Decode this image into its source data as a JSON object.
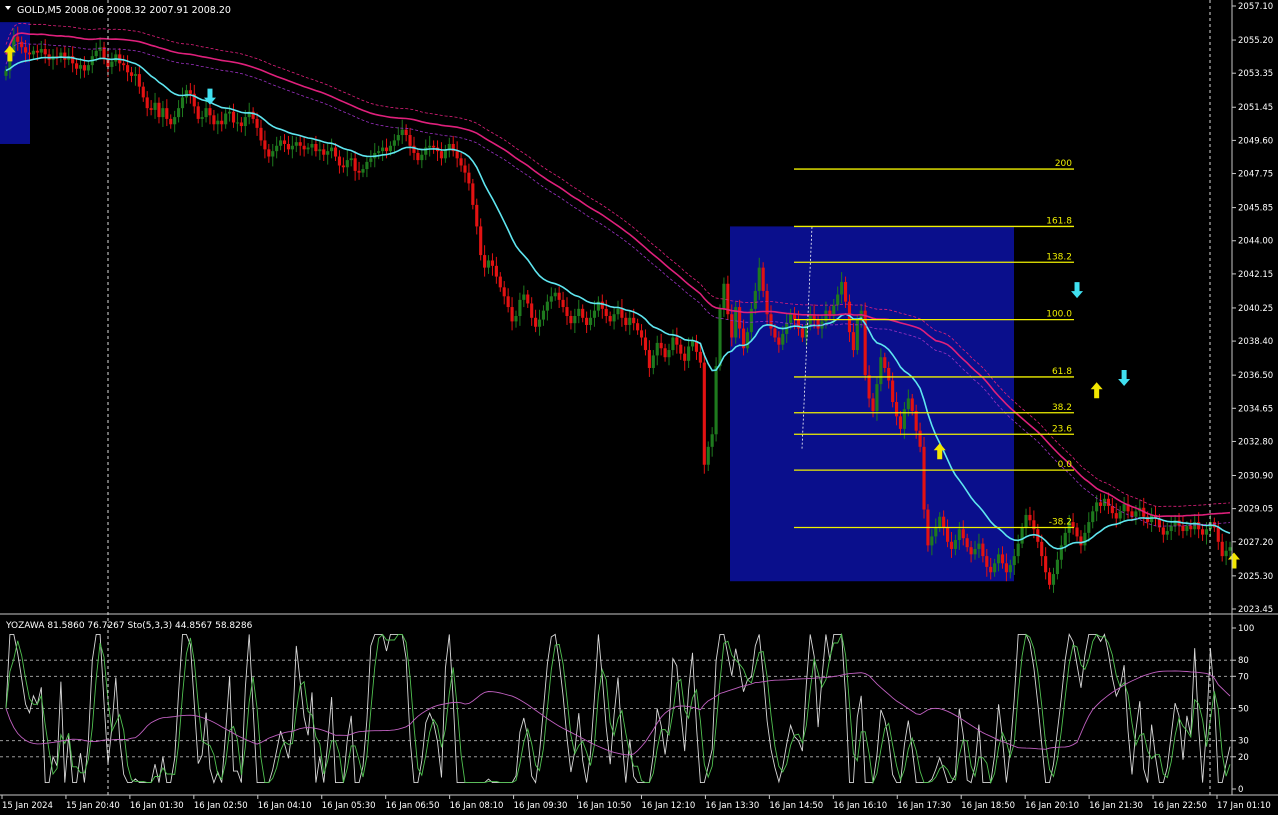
{
  "header": {
    "symbol_text": "GOLD,M5  2008.06 2008.32 2007.91 2008.20",
    "indicator_text": "YOZAWA 81.5860 76.7267  Sto(5,3,3) 44.8567 58.8286"
  },
  "colors": {
    "background": "#000000",
    "bull": "#1e7a1e",
    "bear": "#e31212",
    "ma_fast": "#5fe6f0",
    "ma_slow": "#e0207c",
    "fib_zone": "#0a0f8c",
    "fib_line": "#f0f000",
    "arrow_up": "#f2e600",
    "arrow_down": "#40e0f0",
    "grid": "#b4b4b4",
    "axis_text": "#ffffff",
    "osc_fast": "#d8d8d8",
    "osc_signal": "#c060c0",
    "osc_third": "#50c050"
  },
  "chart_data": [
    {
      "type": "candlestick",
      "title": "GOLD,M5  2008.06 2008.32 2007.91 2008.20",
      "ylim": [
        2023.45,
        2057.1
      ],
      "price_ticks": [
        "2057.10",
        "2055.20",
        "2053.35",
        "2051.45",
        "2049.60",
        "2047.75",
        "2045.85",
        "2044.00",
        "2042.15",
        "2040.25",
        "2038.40",
        "2036.50",
        "2034.65",
        "2032.80",
        "2030.90",
        "2029.05",
        "2027.20",
        "2025.30",
        "2023.45"
      ],
      "time_ticks": [
        "15 Jan 2024",
        "15 Jan 20:40",
        "16 Jan 01:30",
        "16 Jan 02:50",
        "16 Jan 04:10",
        "16 Jan 05:30",
        "16 Jan 06:50",
        "16 Jan 08:10",
        "16 Jan 09:30",
        "16 Jan 10:50",
        "16 Jan 12:10",
        "16 Jan 13:30",
        "16 Jan 14:50",
        "16 Jan 16:10",
        "16 Jan 17:30",
        "16 Jan 18:50",
        "16 Jan 20:10",
        "16 Jan 21:30",
        "16 Jan 22:50",
        "17 Jan 01:10"
      ],
      "closes": [
        2053.5,
        2054.6,
        2055.4,
        2055.1,
        2054.8,
        2054.5,
        2054.4,
        2054.6,
        2054.5,
        2054.7,
        2054.4,
        2054.1,
        2054.3,
        2054.2,
        2054.5,
        2054.1,
        2054.3,
        2053.9,
        2053.6,
        2053.8,
        2053.5,
        2053.8,
        2054.3,
        2054.6,
        2054.8,
        2054.2,
        2053.7,
        2054.0,
        2054.4,
        2053.9,
        2053.8,
        2053.4,
        2053.2,
        2053.3,
        2052.6,
        2052.0,
        2051.4,
        2051.3,
        2051.7,
        2050.9,
        2051.4,
        2050.8,
        2050.5,
        2050.9,
        2051.4,
        2052.0,
        2052.4,
        2052.2,
        2051.5,
        2050.8,
        2050.9,
        2051.4,
        2051.0,
        2050.5,
        2050.7,
        2050.5,
        2051.1,
        2051.2,
        2050.6,
        2050.6,
        2050.4,
        2050.9,
        2051.2,
        2050.8,
        2050.3,
        2049.6,
        2049.1,
        2048.7,
        2049.0,
        2049.3,
        2049.6,
        2049.4,
        2049.1,
        2049.3,
        2049.5,
        2049.3,
        2049.1,
        2049.2,
        2049.4,
        2049.0,
        2049.1,
        2048.8,
        2049.0,
        2049.2,
        2048.7,
        2048.2,
        2048.1,
        2048.5,
        2048.6,
        2047.9,
        2047.8,
        2048.0,
        2048.4,
        2048.6,
        2048.9,
        2049.0,
        2049.2,
        2049.0,
        2049.3,
        2049.6,
        2049.9,
        2050.2,
        2049.9,
        2049.3,
        2048.9,
        2048.5,
        2048.8,
        2049.2,
        2049.3,
        2049.2,
        2049.0,
        2048.6,
        2049.1,
        2049.4,
        2049.0,
        2048.6,
        2048.2,
        2047.8,
        2047.2,
        2046.0,
        2044.8,
        2043.2,
        2042.5,
        2042.9,
        2042.6,
        2042.0,
        2041.4,
        2040.9,
        2040.3,
        2039.5,
        2039.8,
        2040.7,
        2041.0,
        2040.5,
        2039.7,
        2039.2,
        2039.6,
        2040.1,
        2040.6,
        2040.9,
        2041.1,
        2040.7,
        2040.3,
        2039.8,
        2039.4,
        2039.8,
        2040.2,
        2039.7,
        2039.3,
        2039.7,
        2040.1,
        2040.6,
        2040.2,
        2039.8,
        2039.5,
        2039.9,
        2040.2,
        2039.7,
        2039.3,
        2039.7,
        2039.4,
        2039.0,
        2038.6,
        2037.9,
        2036.9,
        2037.6,
        2038.3,
        2038.0,
        2037.5,
        2037.9,
        2038.6,
        2038.2,
        2037.7,
        2037.3,
        2038.1,
        2038.4,
        2037.8,
        2037.2,
        2031.5,
        2032.5,
        2033.2,
        2037.0,
        2040.2,
        2041.6,
        2039.9,
        2038.6,
        2040.3,
        2039.1,
        2038.0,
        2038.9,
        2040.2,
        2041.2,
        2042.5,
        2041.2,
        2039.9,
        2039.1,
        2038.6,
        2038.2,
        2038.8,
        2039.4,
        2039.9,
        2039.6,
        2039.1,
        2038.6,
        2039.3,
        2039.9,
        2039.6,
        2039.1,
        2039.5,
        2040.1,
        2039.8,
        2040.4,
        2041.0,
        2041.7,
        2040.6,
        2038.9,
        2037.9,
        2039.6,
        2040.1,
        2036.5,
        2035.2,
        2034.5,
        2036.0,
        2037.5,
        2036.9,
        2036.2,
        2035.0,
        2034.2,
        2033.5,
        2034.6,
        2035.2,
        2034.5,
        2033.4,
        2032.5,
        2029.0,
        2027.0,
        2027.5,
        2028.0,
        2028.6,
        2028.0,
        2027.2,
        2026.8,
        2027.3,
        2027.9,
        2027.4,
        2026.9,
        2026.5,
        2026.8,
        2027.1,
        2026.4,
        2025.8,
        2025.5,
        2026.0,
        2026.5,
        2026.0,
        2025.5,
        2025.9,
        2026.4,
        2027.1,
        2028.0,
        2028.7,
        2028.4,
        2027.9,
        2027.2,
        2026.4,
        2025.5,
        2024.8,
        2025.4,
        2026.2,
        2027.0,
        2027.7,
        2028.3,
        2028.0,
        2027.5,
        2027.0,
        2027.7,
        2028.3,
        2028.9,
        2029.4,
        2029.2,
        2029.6,
        2029.2,
        2028.8,
        2028.5,
        2028.9,
        2029.3,
        2028.9,
        2028.6,
        2028.9,
        2029.1,
        2028.6,
        2028.3,
        2028.7,
        2028.5,
        2028.0,
        2027.6,
        2027.8,
        2028.1,
        2028.4,
        2028.1,
        2027.8,
        2028.1,
        2027.9,
        2028.3,
        2027.9,
        2027.6,
        2027.9,
        2028.3,
        2028.0,
        2027.2,
        2026.4,
        2026.7,
        2026.9
      ],
      "fibonacci": {
        "levels": [
          {
            "label": "200",
            "price": 2048.0
          },
          {
            "label": "161.8",
            "price": 2044.8
          },
          {
            "label": "138.2",
            "price": 2042.8
          },
          {
            "label": "100.0",
            "price": 2039.6
          },
          {
            "label": "61.8",
            "price": 2036.4
          },
          {
            "label": "38.2",
            "price": 2034.4
          },
          {
            "label": "23.6",
            "price": 2033.2
          },
          {
            "label": "0.0",
            "price": 2031.2
          },
          {
            "label": "-38.2",
            "price": 2028.0
          }
        ]
      },
      "signals": [
        {
          "type": "up",
          "bar": 1,
          "price": 2054.4
        },
        {
          "type": "down",
          "bar": 52,
          "price": 2052.1
        },
        {
          "type": "up",
          "bar": 238,
          "price": 2032.2
        },
        {
          "type": "down",
          "bar": 273,
          "price": 2041.3
        },
        {
          "type": "up",
          "bar": 278,
          "price": 2035.6
        },
        {
          "type": "down",
          "bar": 285,
          "price": 2036.4
        },
        {
          "type": "up",
          "bar": 313,
          "price": 2026.1
        }
      ]
    },
    {
      "type": "line",
      "title": "YOZAWA 81.5860 76.7267  Sto(5,3,3) 44.8567 58.8286",
      "ylim": [
        0,
        100
      ],
      "levels": [
        "100",
        "80",
        "70",
        "50",
        "30",
        "20",
        "0"
      ]
    }
  ]
}
